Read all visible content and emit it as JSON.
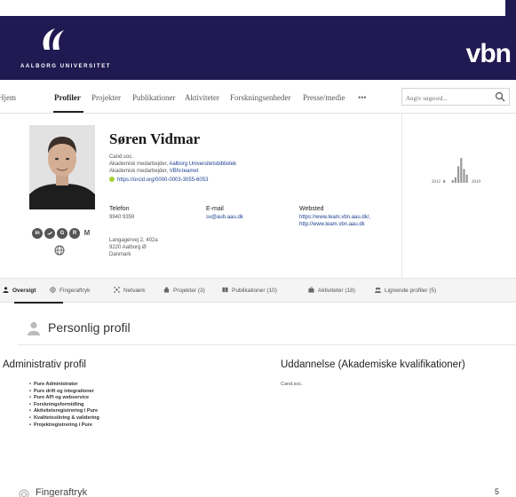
{
  "header": {
    "university_name": "AALBORG UNIVERSITET",
    "brand": "vbn",
    "logo": "aau-logo-icon"
  },
  "nav": {
    "items": [
      "Hjem",
      "Profiler",
      "Projekter",
      "Publikationer",
      "Aktiviteter",
      "Forskningsenheder",
      "Presse/medie",
      "•••"
    ],
    "active": "Profiler",
    "search_placeholder": "Angiv søgeord..."
  },
  "profile": {
    "name": "Søren Vidmar",
    "degree": "Cand.soc.",
    "role1_prefix": "Akademisk medarbejder, ",
    "role1_org": "Aalborg Universitetsbibliotek",
    "role2_prefix": "Akademisk medarbejder, ",
    "role2_org": "VBN-teamet",
    "orcid": "https://orcid.org/0000-0003-3055-6053",
    "social_badges": [
      "in",
      "",
      "G",
      "R",
      "M"
    ]
  },
  "contact": {
    "phone_label": "Telefon",
    "phone": "9940 9359",
    "email_label": "E-mail",
    "email": "sv@aub.aau.dk",
    "website_label": "Websted",
    "website1": "https://www.team.vbn.aau.dk/,",
    "website2": "http://www.team.vbn.aau.dk",
    "address1": "Langagervej 2, 402a",
    "address2": "9220 Aalborg Ø",
    "address3": "Danmark"
  },
  "chart_data": {
    "type": "bar",
    "x_start_label": "2012",
    "x_end_label": "2019",
    "values": [
      1,
      0,
      0,
      1,
      2,
      6,
      9,
      5,
      3
    ]
  },
  "tabs": [
    {
      "label": "Oversigt",
      "icon": "person-icon"
    },
    {
      "label": "Fingeraftryk",
      "icon": "fingerprint-icon"
    },
    {
      "label": "Netværk",
      "icon": "network-icon"
    },
    {
      "label": "Projekter (3)",
      "icon": "projects-icon"
    },
    {
      "label": "Publikationer (10)",
      "icon": "book-icon"
    },
    {
      "label": "Aktiviteter (18)",
      "icon": "briefcase-icon"
    },
    {
      "label": "Lignende profiler (5)",
      "icon": "people-icon"
    }
  ],
  "section": {
    "title": "Personlig profil",
    "admin_title": "Administrativ profil",
    "admin_items": [
      "Pure Administrator",
      "Pure drift og integrationer",
      "Pure API og webservice",
      "Forskningsformidling",
      "Aktivitetsregistrering i Pure",
      "Kvalitetssikring & validering",
      "Projektregistrering i Pure"
    ],
    "edu_title": "Uddannelse (Akademiske kvalifikationer)",
    "edu_value": "Cand.soc."
  },
  "next_section": {
    "title": "Fingeraftryk",
    "count": "5"
  },
  "colors": {
    "header": "#211a52",
    "link": "#1c3f8f",
    "orcid": "#a6ce39"
  }
}
